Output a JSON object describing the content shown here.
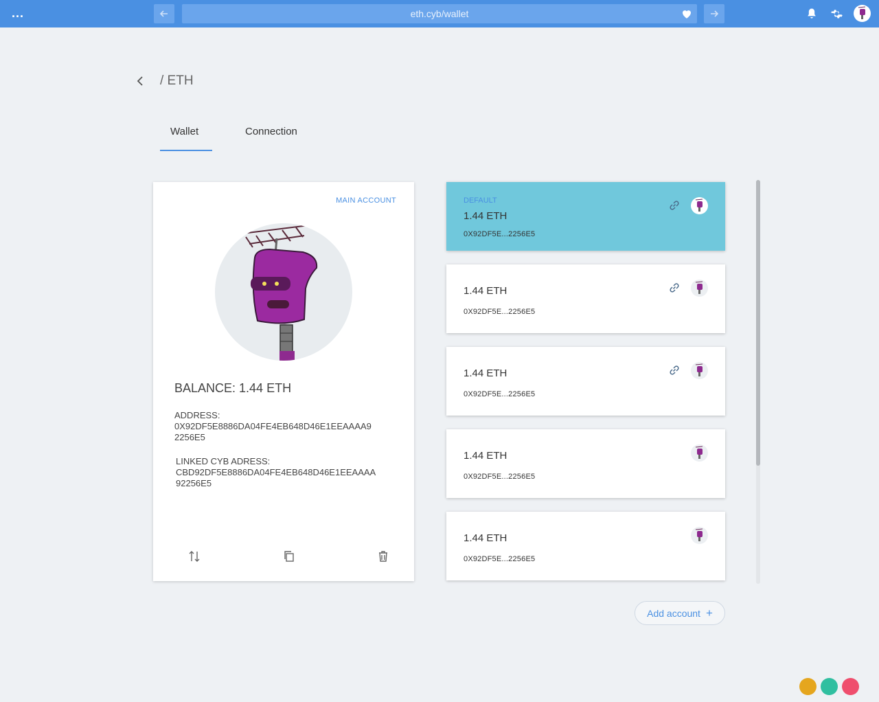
{
  "topbar": {
    "url": "eth.cyb/wallet",
    "menu_label": "..."
  },
  "breadcrumb": {
    "title": "/ ETH"
  },
  "tabs": [
    {
      "label": "Wallet",
      "active": true
    },
    {
      "label": "Connection",
      "active": false
    }
  ],
  "main_account": {
    "tag": "MAIN ACCOUNT",
    "balance": "BALANCE: 1.44 ETH",
    "address_label": "ADDRESS:",
    "address": "0X92DF5E8886DA04FE4EB648D46E1EEAAAA92256E5",
    "linked_label": "LINKED CYB ADRESS:",
    "linked_address": "CBD92DF5E8886DA04FE4EB648D46E1EEAAAA92256E5"
  },
  "accounts": [
    {
      "tag": "DEFAULT",
      "balance": "1.44 ETH",
      "address": "0X92DF5E...2256E5",
      "linked": true,
      "is_default": true
    },
    {
      "tag": "",
      "balance": "1.44 ETH",
      "address": "0X92DF5E...2256E5",
      "linked": true,
      "is_default": false
    },
    {
      "tag": "",
      "balance": "1.44 ETH",
      "address": "0X92DF5E...2256E5",
      "linked": true,
      "is_default": false
    },
    {
      "tag": "",
      "balance": "1.44 ETH",
      "address": "0X92DF5E...2256E5",
      "linked": false,
      "is_default": false
    },
    {
      "tag": "",
      "balance": "1.44 ETH",
      "address": "0X92DF5E...2256E5",
      "linked": false,
      "is_default": false
    }
  ],
  "add_account": {
    "label": "Add account",
    "icon": "+"
  },
  "colors": {
    "accent": "#4a90e2",
    "default_card": "#70c8dc",
    "dot_yellow": "#e5a61e",
    "dot_green": "#30bfa0",
    "dot_red": "#ef4e6d"
  }
}
